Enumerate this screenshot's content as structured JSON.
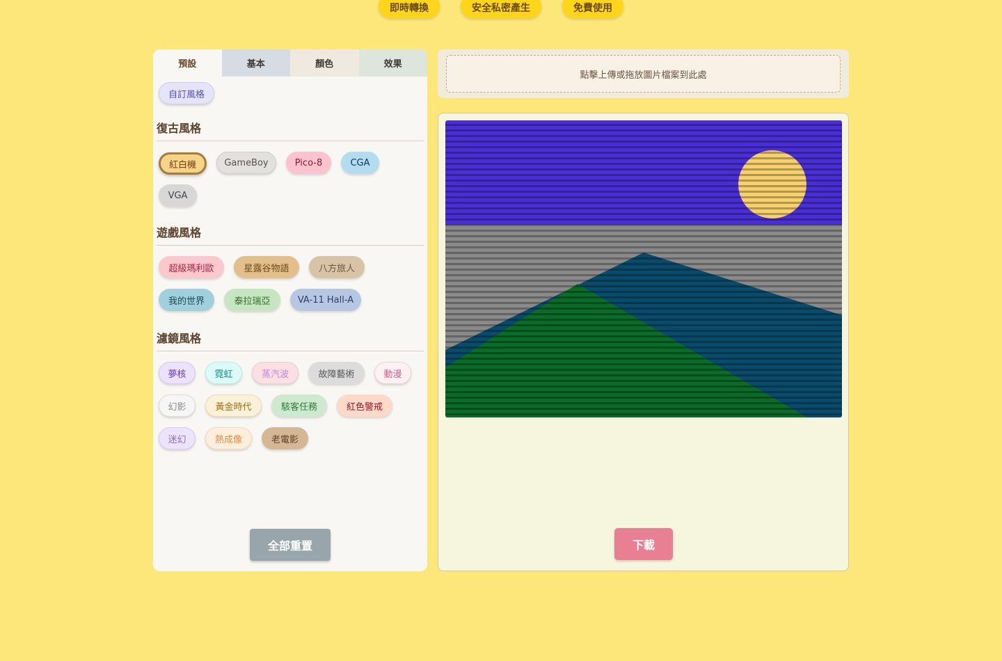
{
  "badges": [
    "即時轉換",
    "安全私密產生",
    "免費使用"
  ],
  "tabs": [
    "預設",
    "基本",
    "顏色",
    "效果"
  ],
  "custom_chip": "自訂風格",
  "sections": {
    "retro": {
      "title": "復古風格",
      "chips": [
        "紅白機",
        "GameBoy",
        "Pico-8",
        "CGA",
        "VGA"
      ],
      "selected": "紅白機"
    },
    "game": {
      "title": "遊戲風格",
      "chips": [
        "超級瑪利歐",
        "星露谷物語",
        "八方旅人",
        "我的世界",
        "泰拉瑞亞",
        "VA-11 Hall-A"
      ]
    },
    "filter": {
      "title": "濾鏡風格",
      "chips": [
        "夢核",
        "霓虹",
        "蒸汽波",
        "故障藝術",
        "動漫",
        "幻影",
        "黃金時代",
        "駭客任務",
        "紅色警戒",
        "迷幻",
        "熱成像",
        "老電影"
      ]
    }
  },
  "reset_label": "全部重置",
  "upload_text": "點擊上傳或拖放圖片檔案到此處",
  "download_label": "下載",
  "colors": {
    "background": "#fee77a",
    "badge": "#fdd51a",
    "download": "#e87f93",
    "reset": "#98a6ab"
  }
}
